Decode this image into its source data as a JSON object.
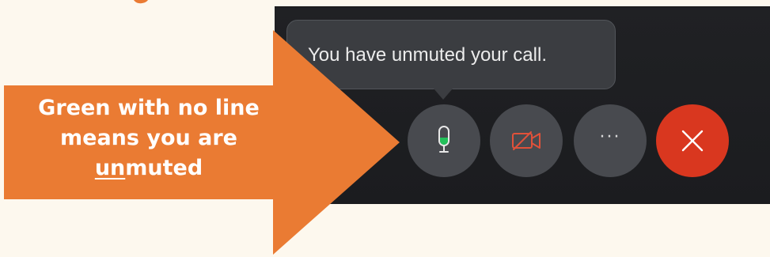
{
  "tooltip": {
    "text": "You have unmuted your call."
  },
  "controls": {
    "more_label": "···"
  },
  "annotation": {
    "line1": "Green with no line",
    "line2": "means you are",
    "line3_underlined": "un",
    "line3_rest": "muted"
  },
  "colors": {
    "arrow": "#ea7b33",
    "background": "#fdf8ee",
    "screen": "#202124",
    "control_button": "#484a4f",
    "end_call": "#d9371f",
    "mic_green": "#22c05a",
    "camera_off_red": "#e0513a"
  },
  "icons": {
    "mic": "microphone-icon",
    "camera": "camera-off-icon",
    "more": "more-options-icon",
    "end": "close-icon"
  }
}
